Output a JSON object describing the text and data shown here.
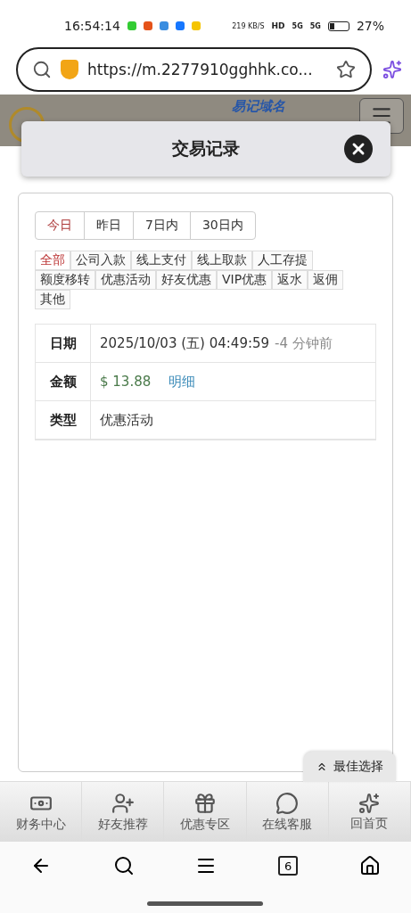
{
  "status_bar": {
    "time": "16:54:14",
    "speed": "219",
    "speed_unit": "KB/S",
    "hd": "HD",
    "networks": [
      "5G",
      "5G"
    ],
    "battery": "27%"
  },
  "browser": {
    "url": "https://m.2277910gghhk.co...",
    "tab_count": "6"
  },
  "site_header": {
    "slogan": "易记域名"
  },
  "modal": {
    "title": "交易记录"
  },
  "period_tabs": [
    {
      "label": "今日",
      "selected": true
    },
    {
      "label": "昨日",
      "selected": false
    },
    {
      "label": "7日内",
      "selected": false
    },
    {
      "label": "30日内",
      "selected": false
    }
  ],
  "type_filters": [
    {
      "label": "全部",
      "selected": true
    },
    {
      "label": "公司入款",
      "selected": false
    },
    {
      "label": "线上支付",
      "selected": false
    },
    {
      "label": "线上取款",
      "selected": false
    },
    {
      "label": "人工存提",
      "selected": false
    },
    {
      "label": "额度移转",
      "selected": false
    },
    {
      "label": "优惠活动",
      "selected": false
    },
    {
      "label": "好友优惠",
      "selected": false
    },
    {
      "label": "VIP优惠",
      "selected": false
    },
    {
      "label": "返水",
      "selected": false
    },
    {
      "label": "返佣",
      "selected": false
    },
    {
      "label": "其他",
      "selected": false
    }
  ],
  "record": {
    "date_label": "日期",
    "date": "2025/10/03 (五) 04:49:59",
    "ago": "-4 分钟前",
    "amount_label": "金额",
    "amount": "$ 13.88",
    "detail_link": "明细",
    "type_label": "类型",
    "type": "优惠活动"
  },
  "float_button": {
    "label": "最佳选择"
  },
  "bottom_nav": [
    {
      "kind": "money",
      "label": "财务中心"
    },
    {
      "kind": "friends",
      "label": "好友推荐"
    },
    {
      "kind": "gift",
      "label": "优惠专区"
    },
    {
      "kind": "chat",
      "label": "在线客服"
    },
    {
      "kind": "home",
      "label": "回首页"
    }
  ]
}
